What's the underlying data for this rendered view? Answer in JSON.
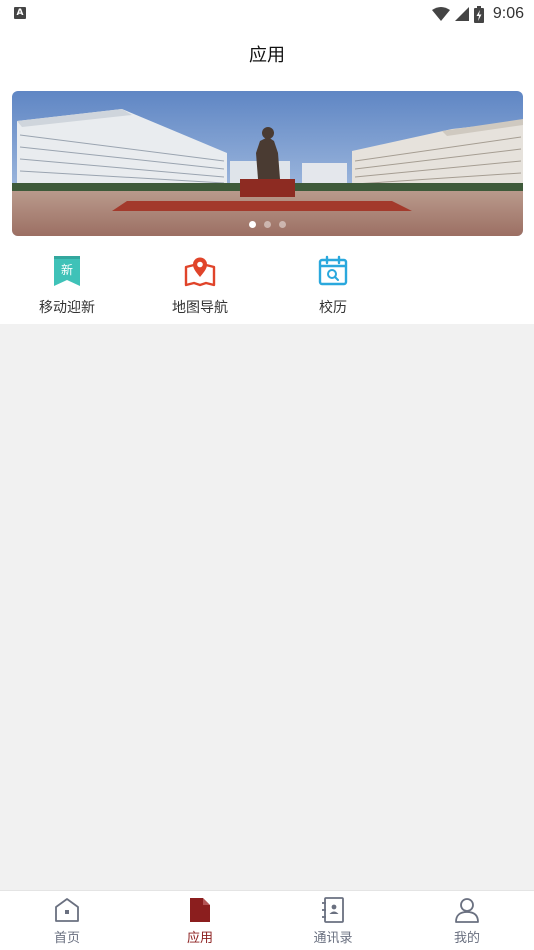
{
  "status_bar": {
    "notification_glyph": "A",
    "time": "9:06",
    "icons": [
      "wifi-icon",
      "signal-icon",
      "battery-charging-icon"
    ]
  },
  "header": {
    "title": "应用"
  },
  "banner": {
    "image": "campus-plaza-with-statue",
    "slide_count": 3,
    "active_slide": 1
  },
  "apps": [
    {
      "label": "移动迎新",
      "icon": "new-student-bookmark-icon",
      "icon_text": "新",
      "color": "#3fc2b8"
    },
    {
      "label": "地图导航",
      "icon": "map-pin-icon",
      "color": "#e0442a"
    },
    {
      "label": "校历",
      "icon": "calendar-search-icon",
      "color": "#2aa8dd"
    }
  ],
  "bottom_nav": [
    {
      "label": "首页",
      "icon": "home-icon",
      "active": false
    },
    {
      "label": "应用",
      "icon": "document-icon",
      "active": true
    },
    {
      "label": "通讯录",
      "icon": "contacts-book-icon",
      "active": false
    },
    {
      "label": "我的",
      "icon": "user-icon",
      "active": false
    }
  ],
  "colors": {
    "accent": "#8b1e1e",
    "inactive_nav": "#6a7080",
    "content_background": "#f1f1f1"
  }
}
